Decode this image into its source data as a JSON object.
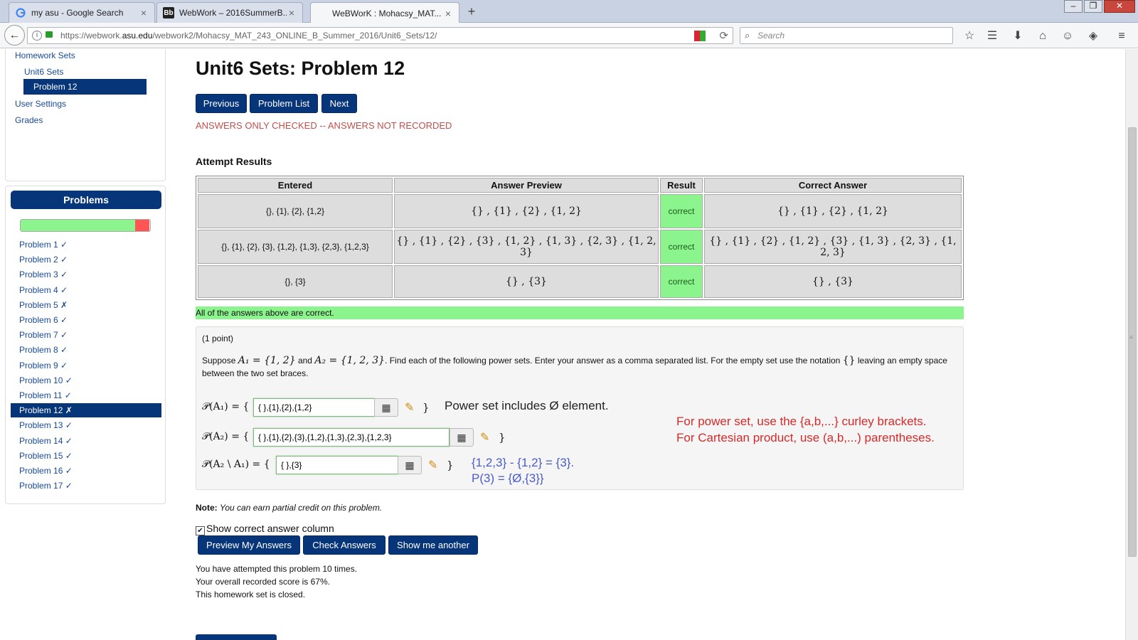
{
  "browser": {
    "tabs": [
      {
        "title": "my asu - Google Search",
        "icon": "google-icon",
        "active": false
      },
      {
        "title": "WebWork – 2016SummerB...",
        "icon": "blackboard-icon",
        "active": false
      },
      {
        "title": "WeBWorK : Mohacsy_MAT...",
        "icon": "",
        "active": true
      }
    ],
    "new_tab": "+",
    "url_prefix": "https://webwork.",
    "url_domain": "asu.edu",
    "url_path": "/webwork2/Mohacsy_MAT_243_ONLINE_B_Summer_2016/Unit6_Sets/12/",
    "search_placeholder": "Search"
  },
  "sidebar": {
    "homework_sets": "Homework Sets",
    "unit": "Unit6 Sets",
    "current_problem": "Problem 12",
    "user_settings": "User Settings",
    "grades": "Grades"
  },
  "problems": {
    "header": "Problems",
    "progress_correct_fraction": 0.875,
    "progress_incorrect_fraction": 0.11,
    "items": [
      "Problem 1 ✓",
      "Problem 2 ✓",
      "Problem 3 ✓",
      "Problem 4 ✓",
      "Problem 5 ✗",
      "Problem 6 ✓",
      "Problem 7 ✓",
      "Problem 8 ✓",
      "Problem 9 ✓",
      "Problem 10 ✓",
      "Problem 11 ✓",
      "Problem 12 ✗",
      "Problem 13 ✓",
      "Problem 14 ✓",
      "Problem 15 ✓",
      "Problem 16 ✓",
      "Problem 17 ✓"
    ],
    "current_index": 11
  },
  "main": {
    "title": "Unit6 Sets: Problem 12",
    "buttons": {
      "previous": "Previous",
      "problem_list": "Problem List",
      "next": "Next"
    },
    "not_recorded": "ANSWERS ONLY CHECKED -- ANSWERS NOT RECORDED",
    "attempt_results": "Attempt Results",
    "table": {
      "headers": [
        "Entered",
        "Answer Preview",
        "Result",
        "Correct Answer"
      ],
      "rows": [
        {
          "entered": "{}, {1}, {2}, {1,2}",
          "preview": "{} , {1} , {2} , {1, 2}",
          "result": "correct",
          "correct": "{} , {1} , {2} , {1, 2}"
        },
        {
          "entered": "{}, {1}, {2}, {3}, {1,2}, {1,3}, {2,3}, {1,2,3}",
          "preview": "{} , {1} , {2} , {3} , {1, 2} , {1, 3} , {2, 3} , {1, 2, 3}",
          "result": "correct",
          "correct": "{} , {1} , {2} , {1, 2} , {3} , {1, 3} , {2, 3} , {1, 2, 3}"
        },
        {
          "entered": "{}, {3}",
          "preview": "{} , {3}",
          "result": "correct",
          "correct": "{} , {3}"
        }
      ]
    },
    "all_correct": "All of the answers above are correct.",
    "points": "(1 point)",
    "statement": {
      "suppose": "Suppose",
      "a1_def": "A₁ = {1, 2}",
      "and": "and",
      "a2_def": "A₂ = {1, 2, 3}",
      "rest": ". Find each of the following power sets. Enter your answer as a comma separated list. For the empty set use the notation",
      "empty_notation": "{}",
      "tail": "leaving an empty space between the two set braces."
    },
    "answers": [
      {
        "label": "𝒫(A₁) = {",
        "value": "{ },{1},{2},{1,2}"
      },
      {
        "label": "𝒫(A₂) = {",
        "value": "{ },{1},{2},{3},{1,2},{1,3},{2,3},{1,2,3}"
      },
      {
        "label": "𝒫(A₂ \\ A₁) = {",
        "value": "{ },{3}"
      }
    ],
    "close_brace": "}",
    "annotations": {
      "power_set_note": "Power set includes Ø element.",
      "red_line1": "For power set, use the {a,b,...} curley brackets.",
      "red_line2": "For Cartesian product, use (a,b,...) parentheses.",
      "blue_line1": "{1,2,3} - {1,2} = {3}.",
      "blue_line2": "P(3) = {Ø,{3}}"
    },
    "note_label": "Note:",
    "note_text": "You can earn partial credit on this problem.",
    "show_correct_label": "Show correct answer column",
    "action_buttons": {
      "preview": "Preview My Answers",
      "check": "Check Answers",
      "another": "Show me another"
    },
    "status": [
      "You have attempted this problem 10 times.",
      "Your overall recorded score is 67%.",
      "This homework set is closed."
    ]
  },
  "colors": {
    "nav_blue": "#06357a",
    "correct_green": "#8cf48c",
    "warning_red": "#c0504d",
    "annotation_red": "#d62a2a",
    "annotation_blue": "#4a5ccc"
  }
}
